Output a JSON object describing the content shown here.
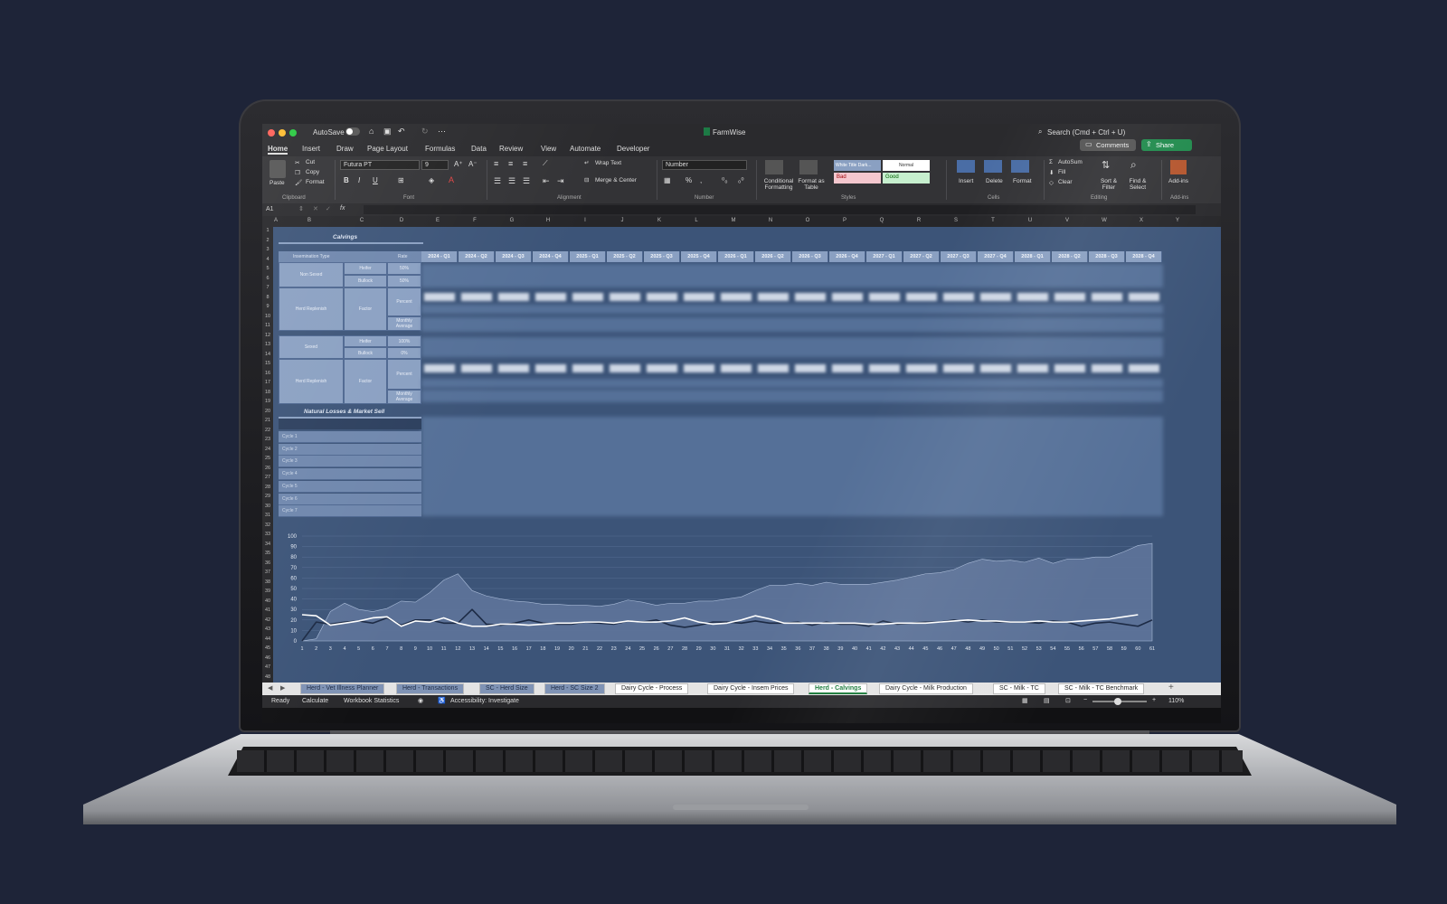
{
  "window": {
    "autosave_label": "AutoSave",
    "title": "FarmWise",
    "search_placeholder": "Search (Cmd + Ctrl + U)",
    "comments_label": "Comments",
    "share_label": "Share"
  },
  "ribbon_tabs": [
    "Home",
    "Insert",
    "Draw",
    "Page Layout",
    "Formulas",
    "Data",
    "Review",
    "View",
    "Automate",
    "Developer"
  ],
  "ribbon": {
    "paste": "Paste",
    "cut": "Cut",
    "copy": "Copy",
    "format": "Format",
    "font_name": "Futura PT",
    "font_size": "9",
    "wrap_text": "Wrap Text",
    "merge_center": "Merge & Center",
    "number_format": "Number",
    "conditional_formatting": "Conditional Formatting",
    "format_as_table": "Format as Table",
    "style_white": "White Title Dark...",
    "style_normal": "Normal",
    "style_bad": "Bad",
    "style_good": "Good",
    "insert": "Insert",
    "delete": "Delete",
    "format_cells": "Format",
    "autosum": "AutoSum",
    "fill": "Fill",
    "clear": "Clear",
    "sort_filter": "Sort & Filter",
    "find_select": "Find & Select",
    "add_ins": "Add-ins",
    "groups": {
      "clipboard": "Clipboard",
      "font": "Font",
      "alignment": "Alignment",
      "number": "Number",
      "styles": "Styles",
      "cells": "Cells",
      "editing": "Editing",
      "add_ins": "Add-ins"
    }
  },
  "formula_bar": {
    "cell_ref": "A1",
    "fx": "fx"
  },
  "columns": [
    "A",
    "B",
    "C",
    "D",
    "E",
    "F",
    "G",
    "H",
    "I",
    "J",
    "K",
    "L",
    "M",
    "N",
    "O",
    "P",
    "Q",
    "R",
    "S",
    "T",
    "U",
    "V",
    "W",
    "X",
    "Y"
  ],
  "rows": [
    "1",
    "2",
    "3",
    "4",
    "5",
    "6",
    "7",
    "8",
    "9",
    "10",
    "11",
    "12",
    "13",
    "14",
    "15",
    "16",
    "17",
    "18",
    "19",
    "20",
    "21",
    "22",
    "23",
    "24",
    "25",
    "26",
    "27",
    "28",
    "29",
    "30",
    "31",
    "32",
    "33",
    "34",
    "35",
    "36",
    "37",
    "38",
    "39",
    "40",
    "41",
    "42",
    "43",
    "44",
    "45",
    "46",
    "47",
    "48"
  ],
  "sheet": {
    "calvings_title": "Calvings",
    "insemination_type": "Insemination Type",
    "rate": "Rate",
    "non_sexed": "Non Sexed",
    "sexed": "Sexed",
    "heifer": "Heifer",
    "bullock": "Bullock",
    "herd_replenish": "Herd Replenish",
    "factor": "Factor",
    "percent": "Percent",
    "monthly_average": "Monthly Average",
    "ns_heifer_rate": "50%",
    "ns_bullock_rate": "50%",
    "s_heifer_rate": "100%",
    "s_bullock_rate": "0%",
    "losses_title": "Natural Losses & Market Sell",
    "cycles": [
      "Cycle 1",
      "Cycle 2",
      "Cycle 3",
      "Cycle 4",
      "Cycle 5",
      "Cycle 6",
      "Cycle 7"
    ],
    "quarters": [
      "2024 - Q1",
      "2024 - Q2",
      "2024 - Q3",
      "2024 - Q4",
      "2025 - Q1",
      "2025 - Q2",
      "2025 - Q3",
      "2025 - Q4",
      "2026 - Q1",
      "2026 - Q2",
      "2026 - Q3",
      "2026 - Q4",
      "2027 - Q1",
      "2027 - Q2",
      "2027 - Q3",
      "2027 - Q4",
      "2028 - Q1",
      "2028 - Q2",
      "2028 - Q3",
      "2028 - Q4"
    ]
  },
  "chart_data": {
    "type": "area",
    "ylim": [
      0,
      100
    ],
    "yticks": [
      0,
      10,
      20,
      30,
      40,
      50,
      60,
      70,
      80,
      90,
      100
    ],
    "x": [
      1,
      2,
      3,
      4,
      5,
      6,
      7,
      8,
      9,
      10,
      11,
      12,
      13,
      14,
      15,
      16,
      17,
      18,
      19,
      20,
      21,
      22,
      23,
      24,
      25,
      26,
      27,
      28,
      29,
      30,
      31,
      32,
      33,
      34,
      35,
      36,
      37,
      38,
      39,
      40,
      41,
      42,
      43,
      44,
      45,
      46,
      47,
      48,
      49,
      50,
      51,
      52,
      53,
      54,
      55,
      56,
      57,
      58,
      59,
      60,
      61
    ],
    "series": [
      {
        "type": "area",
        "color": "#5d7399",
        "values": [
          0,
          2,
          28,
          36,
          30,
          28,
          31,
          38,
          37,
          46,
          58,
          64,
          48,
          43,
          40,
          38,
          37,
          35,
          35,
          34,
          34,
          33,
          35,
          39,
          37,
          34,
          36,
          36,
          38,
          38,
          40,
          42,
          48,
          53,
          53,
          55,
          53,
          56,
          54,
          54,
          54,
          56,
          58,
          61,
          64,
          65,
          68,
          74,
          78,
          76,
          77,
          75,
          79,
          74,
          78,
          78,
          80,
          80,
          85,
          91,
          93
        ]
      },
      {
        "type": "line",
        "color": "#1c2a44",
        "values": [
          0,
          18,
          16,
          18,
          19,
          17,
          22,
          15,
          20,
          20,
          17,
          17,
          30,
          16,
          15,
          17,
          20,
          17,
          16,
          16,
          18,
          17,
          16,
          19,
          18,
          20,
          15,
          13,
          15,
          18,
          18,
          17,
          19,
          17,
          17,
          18,
          15,
          18,
          16,
          16,
          14,
          19,
          16,
          17,
          18,
          18,
          20,
          18,
          20,
          18,
          18,
          18,
          17,
          19,
          18,
          14,
          17,
          18,
          16,
          14,
          20
        ]
      },
      {
        "type": "line",
        "color": "#ffffff",
        "values": [
          25,
          24,
          15,
          17,
          19,
          22,
          23,
          14,
          19,
          18,
          22,
          17,
          14,
          14,
          16,
          16,
          15,
          16,
          17,
          17,
          18,
          18,
          17,
          19,
          18,
          18,
          19,
          22,
          18,
          16,
          17,
          20,
          24,
          21,
          17,
          17,
          17,
          17,
          17,
          17,
          16,
          16,
          17,
          17,
          17,
          18,
          19,
          20,
          19,
          19,
          18,
          18,
          19,
          18,
          18,
          19,
          20,
          21,
          23,
          25
        ]
      }
    ]
  },
  "sheet_tabs": [
    "Herd - Vet Illness Planner",
    "Herd - Transactions",
    "SC - Herd Size",
    "Herd - SC Size 2",
    "Dairy Cycle - Process",
    "Dairy Cycle - Insem Prices",
    "Herd - Calvings",
    "Dairy Cycle - Milk Production",
    "SC - Milk - TC",
    "SC - Milk - TC Benchmark"
  ],
  "status": {
    "ready": "Ready",
    "calculate": "Calculate",
    "workbook_statistics": "Workbook Statistics",
    "accessibility": "Accessibility: Investigate",
    "zoom": "110%"
  }
}
